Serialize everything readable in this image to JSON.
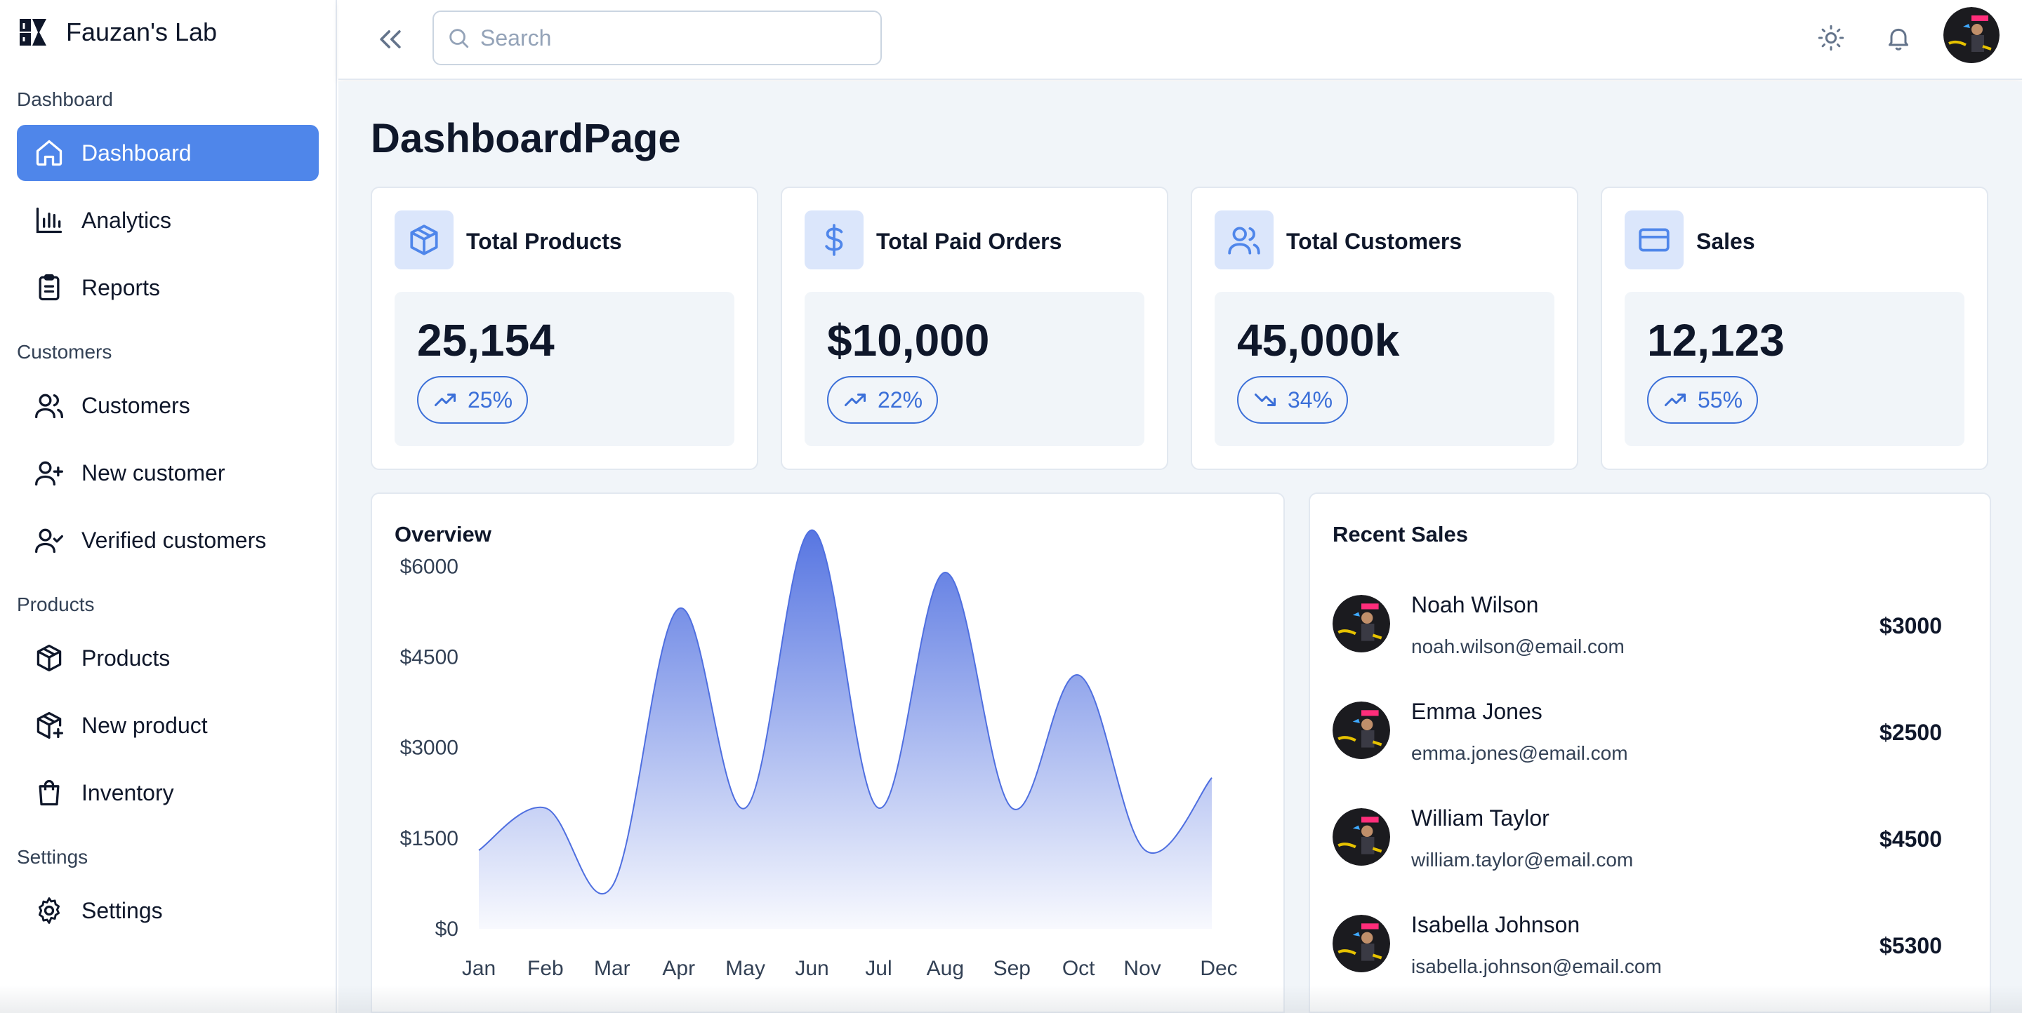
{
  "brand": {
    "name": "Fauzan's Lab",
    "logo_icon": "lab-logo-icon"
  },
  "sidebar": {
    "sections": [
      {
        "title": "Dashboard",
        "items": [
          {
            "label": "Dashboard",
            "icon": "home-icon",
            "active": true
          },
          {
            "label": "Analytics",
            "icon": "bar-chart-icon"
          },
          {
            "label": "Reports",
            "icon": "clipboard-icon"
          }
        ]
      },
      {
        "title": "Customers",
        "items": [
          {
            "label": "Customers",
            "icon": "users-icon"
          },
          {
            "label": "New customer",
            "icon": "user-plus-icon"
          },
          {
            "label": "Verified customers",
            "icon": "user-check-icon"
          }
        ]
      },
      {
        "title": "Products",
        "items": [
          {
            "label": "Products",
            "icon": "package-icon"
          },
          {
            "label": "New product",
            "icon": "package-plus-icon"
          },
          {
            "label": "Inventory",
            "icon": "shopping-bag-icon"
          }
        ]
      },
      {
        "title": "Settings",
        "items": [
          {
            "label": "Settings",
            "icon": "gear-icon"
          }
        ]
      }
    ]
  },
  "topbar": {
    "search_placeholder": "Search",
    "search_value": ""
  },
  "page": {
    "title": "DashboardPage"
  },
  "stats": [
    {
      "title": "Total Products",
      "value": "25,154",
      "change": "25%",
      "trend": "up",
      "icon": "box-icon"
    },
    {
      "title": "Total Paid Orders",
      "value": "$10,000",
      "change": "22%",
      "trend": "up",
      "icon": "dollar-icon"
    },
    {
      "title": "Total Customers",
      "value": "45,000k",
      "change": "34%",
      "trend": "down",
      "icon": "users-icon"
    },
    {
      "title": "Sales",
      "value": "12,123",
      "change": "55%",
      "trend": "up",
      "icon": "credit-card-icon"
    }
  ],
  "overview": {
    "title": "Overview",
    "chart_data": {
      "type": "area",
      "categories": [
        "Jan",
        "Feb",
        "Mar",
        "Apr",
        "May",
        "Jun",
        "Jul",
        "Aug",
        "Sep",
        "Oct",
        "Nov",
        "Dec"
      ],
      "values": [
        1300,
        2000,
        700,
        5300,
        2000,
        6600,
        2000,
        5900,
        2000,
        4200,
        1300,
        2500
      ],
      "ytick_labels": [
        "$0",
        "$1500",
        "$3000",
        "$4500",
        "$6000"
      ],
      "ylim": [
        0,
        7200
      ],
      "grid": false,
      "color": "#4f6fe0"
    }
  },
  "recent_sales": {
    "title": "Recent Sales",
    "items": [
      {
        "name": "Noah Wilson",
        "email": "noah.wilson@email.com",
        "amount": "$3000"
      },
      {
        "name": "Emma Jones",
        "email": "emma.jones@email.com",
        "amount": "$2500"
      },
      {
        "name": "William Taylor",
        "email": "william.taylor@email.com",
        "amount": "$4500"
      },
      {
        "name": "Isabella Johnson",
        "email": "isabella.johnson@email.com",
        "amount": "$5300"
      }
    ]
  },
  "colors": {
    "accent": "#4f86ea",
    "badge": "#3b6fd8",
    "background": "#f1f5f9"
  }
}
